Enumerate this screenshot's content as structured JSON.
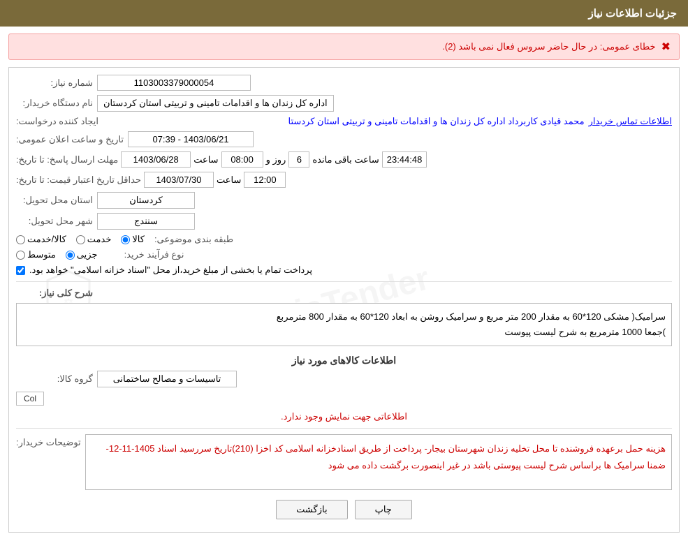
{
  "header": {
    "title": "جزئیات اطلاعات نیاز"
  },
  "error": {
    "text": "خطای عمومی: در حال حاضر سروس فعال نمی باشد (2).",
    "icon": "✖"
  },
  "fields": {
    "need_number_label": "شماره نیاز:",
    "need_number_value": "1103003379000054",
    "buyer_org_label": "نام دستگاه خریدار:",
    "buyer_org_value": "اداره کل زندان ها و اقدامات تامینی و تربیتی استان کردستان",
    "creator_label": "ایجاد کننده درخواست:",
    "creator_value": "محمد  قیادی کاربرداد اداره کل زندان ها و اقدامات تامینی و تربیتی استان کردستا",
    "creator_link": "اطلاعات تماس خریدار",
    "announce_datetime_label": "تاریخ و ساعت اعلان عمومی:",
    "announce_datetime_value": "1403/06/21 - 07:39",
    "deadline_label": "مهلت ارسال پاسخ: تا تاریخ:",
    "deadline_date": "1403/06/28",
    "deadline_time": "08:00",
    "deadline_day": "6",
    "deadline_remaining": "23:44:48",
    "deadline_remaining_label": "ساعت باقی مانده",
    "deadline_day_label": "روز و",
    "deadline_time_label": "ساعت",
    "price_validity_label": "حداقل تاریخ اعتبار قیمت: تا تاریخ:",
    "price_validity_date": "1403/07/30",
    "price_validity_time": "12:00",
    "price_validity_time_label": "ساعت",
    "delivery_province_label": "استان محل تحویل:",
    "delivery_province_value": "کردستان",
    "delivery_city_label": "شهر محل تحویل:",
    "delivery_city_value": "سنندج",
    "category_label": "طبقه بندی موضوعی:",
    "category_options": [
      "کالا",
      "خدمت",
      "کالا/خدمت"
    ],
    "category_selected": "کالا",
    "purchase_type_label": "نوع فرآیند خرید:",
    "purchase_type_options": [
      "جزیی",
      "متوسط"
    ],
    "purchase_type_selected": "جزیی",
    "checkbox_label": "پرداخت تمام یا بخشی از مبلغ خرید،از محل \"اسناد خزانه اسلامی\" خواهد بود.",
    "summary_label": "شرح کلی نیاز:",
    "summary_value": "سرامیک( مشکی  120*60  به مقدار 200 متر مربع  و  سرامیک روشن به ابعاد 120*60 به مقدار 800 مترمربع\n)جمعا 1000 مترمربع به شرح لیست پیوست",
    "goods_section_title": "اطلاعات کالاهای مورد نیاز",
    "goods_group_label": "گروه کالا:",
    "goods_group_value": "تاسیسات و مصالح ساختمانی",
    "no_info_text": "اطلاعاتی جهت نمایش وجود ندارد.",
    "buyer_notes_label": "توضیحات خریدار:",
    "buyer_notes_value": "هزینه حمل برعهده فروشنده  تا محل  تخلیه  زندان  شهرستان بیجار- پرداخت از طریق اسنادخزانه اسلامی کد اخزا (210)تاریخ سررسید اسناد 1405-11-12- ضمنا سرامیک ها براساس شرح لیست پیوستی باشد در غیر اینصورت برگشت داده می شود",
    "col_badge": "Col",
    "btn_print": "چاپ",
    "btn_back": "بازگشت"
  }
}
